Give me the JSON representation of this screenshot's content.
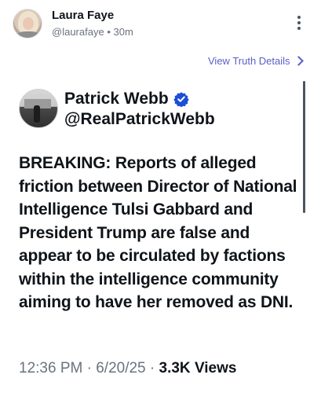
{
  "reposter": {
    "name": "Laura Faye",
    "handle": "@laurafaye",
    "separator": "•",
    "time": "30m"
  },
  "view_details_label": "View Truth Details",
  "post": {
    "author_name": "Patrick Webb",
    "author_handle": "@RealPatrickWebb",
    "verified": true,
    "text": "BREAKING: Reports of alleged friction between Director of National Intelligence Tulsi Gabbard and President Trump are false and appear to be circulated by factions within the intelligence community aiming to have her removed as DNI.",
    "time": "12:36 PM",
    "date": "6/20/25",
    "dot": "·",
    "views_count": "3.3K",
    "views_label": "Views"
  },
  "icons": {
    "menu": "more-vertical-icon",
    "chevron": "chevron-right-icon",
    "verified": "verified-badge-icon"
  },
  "colors": {
    "link": "#5b5fc7",
    "verified_badge": "#1d4ed8",
    "muted": "#6b7280",
    "text": "#0f1419"
  }
}
